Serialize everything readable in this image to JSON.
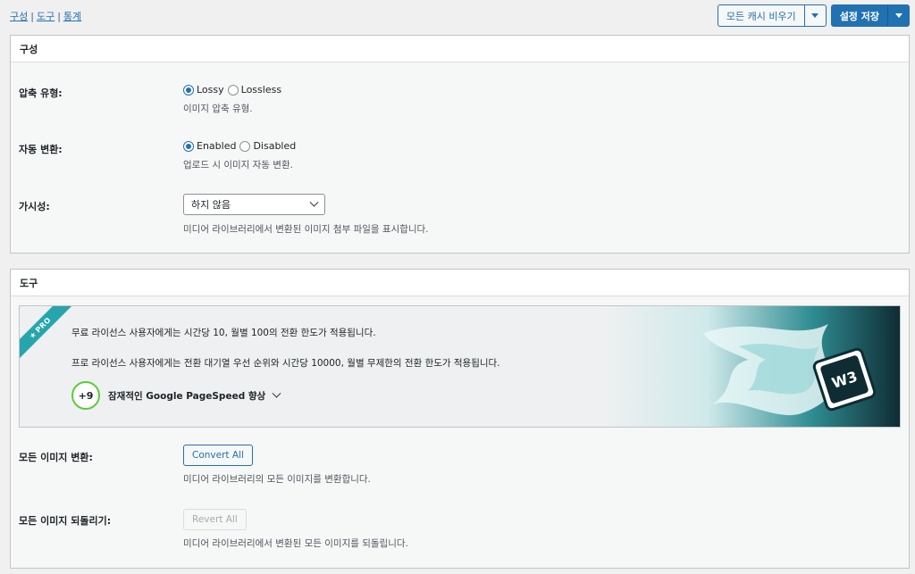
{
  "breadcrumb": {
    "items": [
      "구성",
      "도구",
      "통계"
    ],
    "separator": "|"
  },
  "toolbar": {
    "clear_cache_label": "모든 캐시 비우기",
    "save_label": "설정 저장"
  },
  "config": {
    "title": "구성",
    "compression": {
      "label": "압축 유형:",
      "options": [
        "Lossy",
        "Lossless"
      ],
      "selected": "Lossy",
      "description": "이미지 압축 유형."
    },
    "auto_convert": {
      "label": "자동 변환:",
      "options": [
        "Enabled",
        "Disabled"
      ],
      "selected": "Enabled",
      "description": "업로드 시 이미지 자동 변환."
    },
    "visibility": {
      "label": "가시성:",
      "value": "하지 않음",
      "description": "미디어 라이브러리에서 변환된 이미지 첨부 파일을 표시합니다."
    }
  },
  "tools": {
    "title": "도구",
    "pro": {
      "badge": "PRO",
      "line1": "무료 라이선스 사용자에게는 시간당 10, 월별 100의 전환 한도가 적용됩니다.",
      "line2": "프로 라이선스 사용자에게는 전환 대기열 우선 순위와 시간당 10000, 월별 무제한의 전환 한도가 적용됩니다.",
      "score": "+9",
      "pagespeed_label": "잠재적인 Google PageSpeed 향상",
      "logo_text": "W3"
    },
    "convert_all": {
      "label": "모든 이미지 변환:",
      "button": "Convert All",
      "description": "미디어 라이브러리의 모든 이미지를 변환합니다."
    },
    "revert_all": {
      "label": "모든 이미지 되돌리기:",
      "button": "Revert All",
      "description": "미디어 라이브러리에서 변환된 모든 이미지를 되돌립니다."
    }
  },
  "colors": {
    "accent": "#2271b1",
    "pro_teal": "#27a5ad",
    "gauge_green": "#5ecb3a"
  }
}
